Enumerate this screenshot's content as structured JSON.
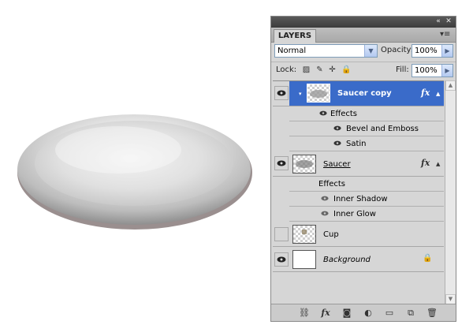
{
  "panel": {
    "tab_label": "LAYERS",
    "blend_mode": "Normal",
    "opacity_label": "Opacity:",
    "opacity_value": "100%",
    "lock_label": "Lock:",
    "fill_label": "Fill:",
    "fill_value": "100%"
  },
  "layers": [
    {
      "name": "Saucer copy",
      "selected": true,
      "visible": true,
      "fx": "fx",
      "effects_label": "Effects",
      "effects": [
        "Bevel and Emboss",
        "Satin"
      ]
    },
    {
      "name": "Saucer",
      "selected": false,
      "visible": true,
      "fx": "fx",
      "effects_label": "Effects",
      "effects": [
        "Inner Shadow",
        "Inner Glow"
      ]
    },
    {
      "name": "Cup",
      "selected": false,
      "visible": false
    },
    {
      "name": "Background",
      "selected": false,
      "visible": true,
      "locked": true
    }
  ],
  "colors": {
    "selection": "#3a6bc9",
    "panel_bg": "#d6d6d6",
    "title_bar": "#4a4a4a"
  },
  "icons": {
    "top_bar": [
      "collapse-icon",
      "close-icon"
    ],
    "bottom_bar": [
      "link-icon",
      "fx-icon",
      "mask-icon",
      "adjustment-icon",
      "group-icon",
      "new-layer-icon",
      "trash-icon"
    ]
  }
}
